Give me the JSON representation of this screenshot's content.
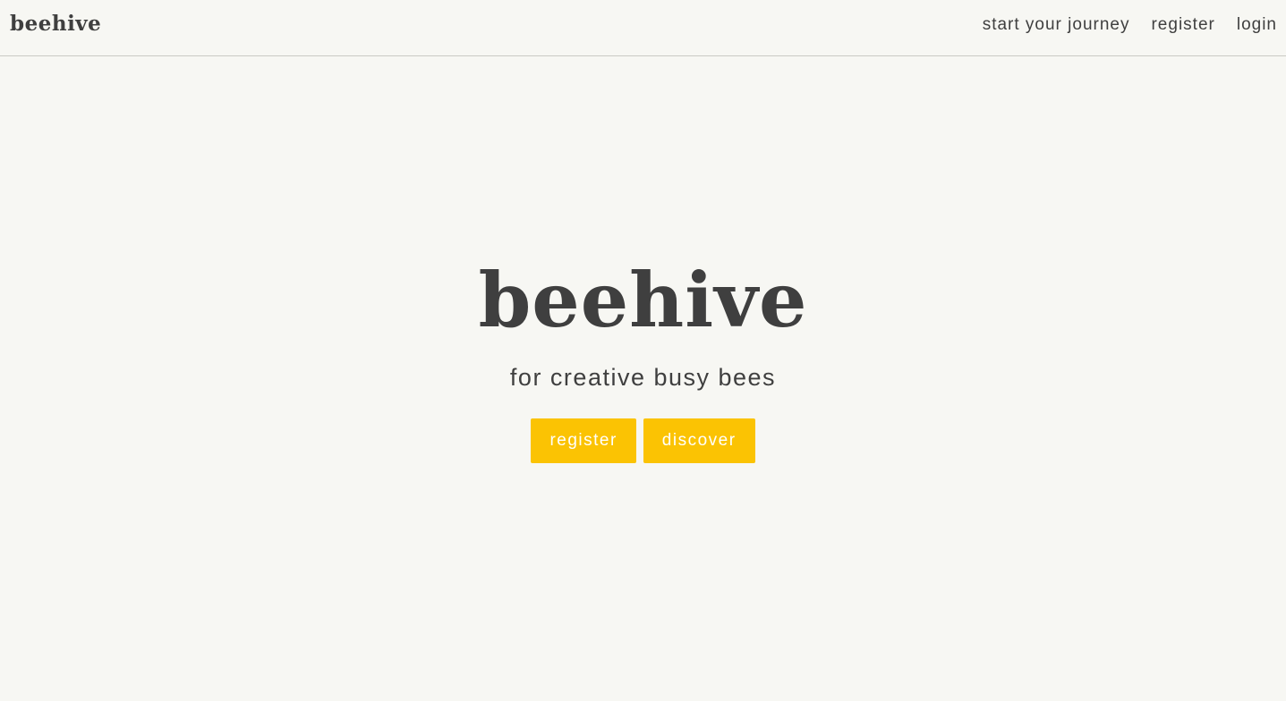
{
  "header": {
    "brand": "beehive",
    "nav": {
      "start": "start your journey",
      "register": "register",
      "login": "login"
    }
  },
  "hero": {
    "title": "beehive",
    "tagline": "for creative busy bees",
    "buttons": {
      "register": "register",
      "discover": "discover"
    }
  },
  "colors": {
    "background": "#f7f7f3",
    "text": "#3f3f3f",
    "accent": "#fbc303",
    "button_text": "#ffffff"
  }
}
